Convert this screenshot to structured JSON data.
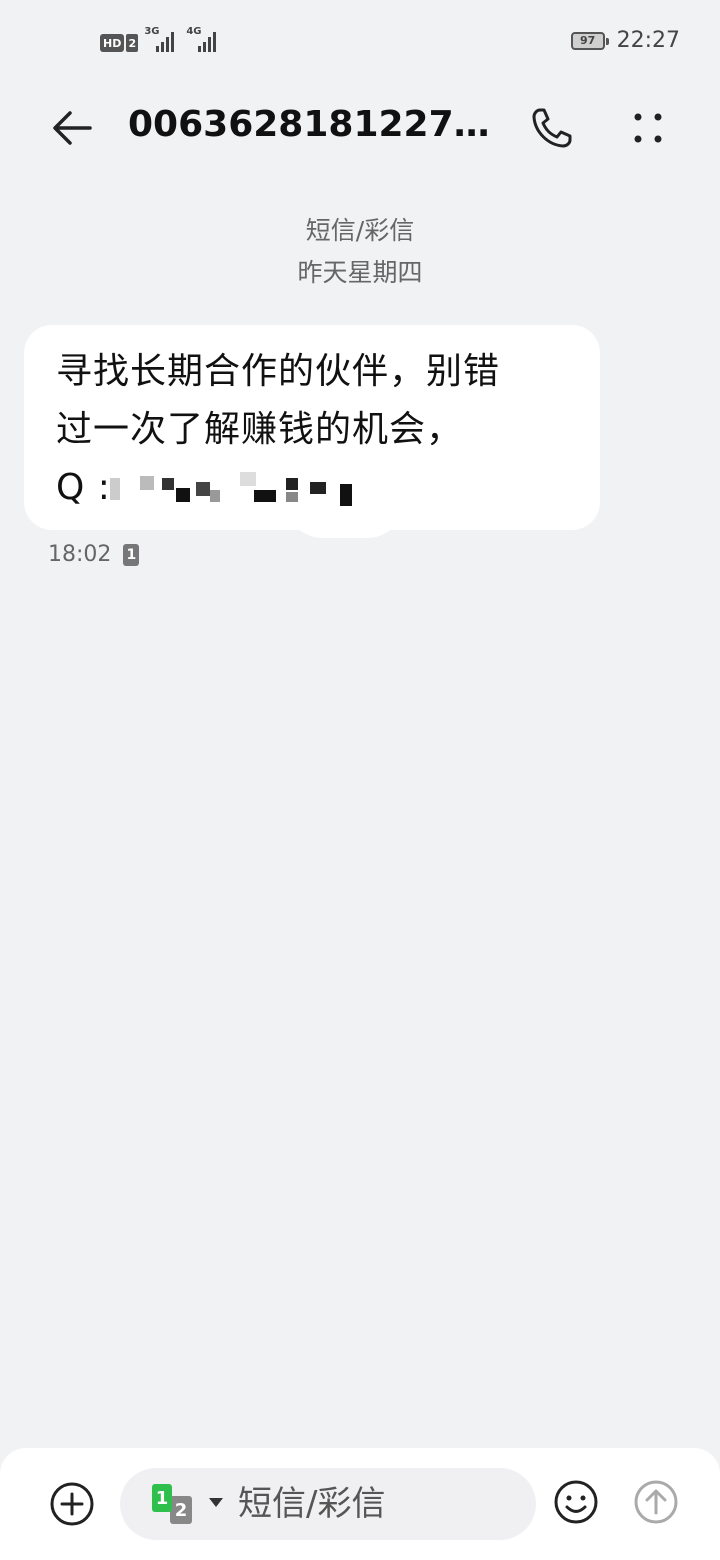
{
  "status_bar": {
    "hd_label": "HD",
    "sim_label": "2",
    "network_1": "3G",
    "network_2": "4G",
    "battery_level": "97",
    "time": "22:27"
  },
  "header": {
    "contact_name": "0063628181227…",
    "icons": {
      "back": "arrow-left-icon",
      "call": "phone-icon",
      "more": "more-dots-icon"
    }
  },
  "thread": {
    "channel_label": "短信/彩信",
    "date_label": "昨天星期四",
    "messages": [
      {
        "text_line1": "寻找长期合作的伙伴，别错",
        "text_line2": "过一次了解赚钱的机会，",
        "text_line3": "Q :",
        "time": "18:02",
        "sim": "1"
      }
    ]
  },
  "input_bar": {
    "sim_primary": "1",
    "sim_secondary": "2",
    "placeholder": "短信/彩信",
    "icons": {
      "add": "plus-circle-icon",
      "emoji": "smiley-icon",
      "send": "send-up-arrow-icon"
    }
  },
  "colors": {
    "background": "#f1f2f4",
    "bubble": "#ffffff",
    "sim_green": "#2fbf4d"
  }
}
